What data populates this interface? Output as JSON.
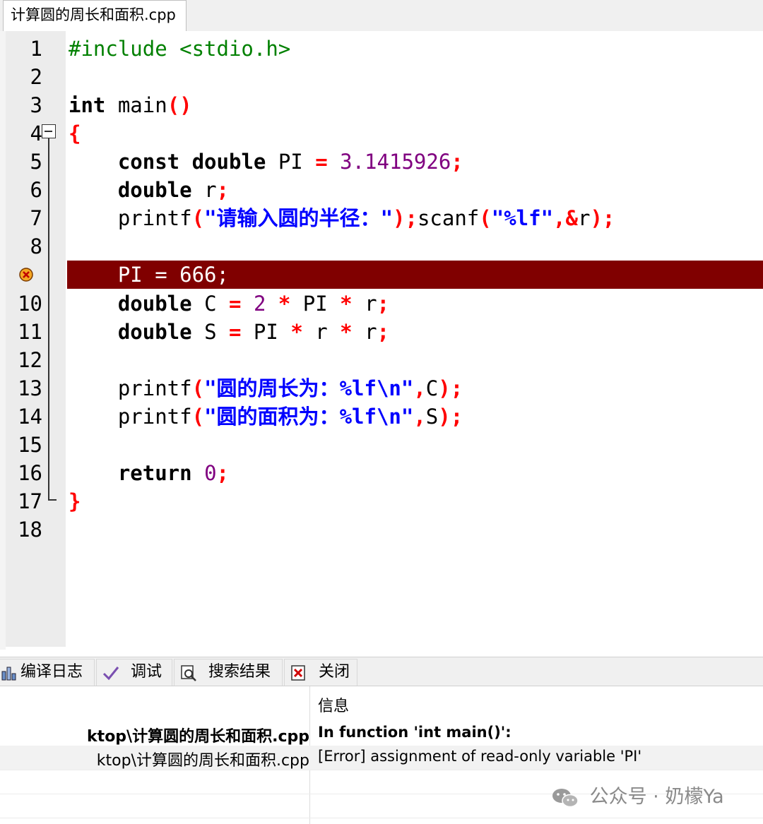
{
  "editor_tab": {
    "filename": "计算圆的周长和面积.cpp"
  },
  "gutter": {
    "line_numbers": [
      "1",
      "2",
      "3",
      "4",
      "5",
      "6",
      "7",
      "8",
      "",
      "10",
      "11",
      "12",
      "13",
      "14",
      "15",
      "16",
      "17",
      "18"
    ],
    "breakpoint_line": 9
  },
  "code": {
    "l1": "#include <stdio.h>",
    "l3": {
      "kw": "int",
      "rest": " main",
      "p": "()"
    },
    "l4": "{",
    "l5": {
      "indent": "    ",
      "kw": "const double",
      "id": " PI ",
      "eq": "=",
      "sp": " ",
      "num": "3.1415926",
      "semi": ";"
    },
    "l6": {
      "indent": "    ",
      "kw": "double",
      "id": " r",
      "semi": ";"
    },
    "l7": {
      "indent": "    ",
      "fn1": "printf",
      "p1": "(",
      "s1q1": "\"",
      "s1": "请输入圆的半径：",
      "s1q2": "\"",
      "p2": ");",
      "fn2": "scanf",
      "p3": "(",
      "s2": "\"%lf\"",
      "c": ",&",
      "id": "r",
      "p4": ");"
    },
    "l9": "    PI = 666;",
    "l10": {
      "indent": "    ",
      "kw": "double",
      "id1": " C ",
      "eq": "=",
      "sp": " ",
      "num": "2",
      "op1": " * ",
      "id2": "PI",
      "op2": " * ",
      "id3": "r",
      "semi": ";"
    },
    "l11": {
      "indent": "    ",
      "kw": "double",
      "id1": " S ",
      "eq": "=",
      "id2": " PI",
      "op1": " * ",
      "id3": "r",
      "op2": " * ",
      "id4": "r",
      "semi": ";"
    },
    "l13": {
      "indent": "    ",
      "fn": "printf",
      "p1": "(",
      "q1": "\"",
      "s": "圆的周长为：",
      "fmt": "%lf\\n\"",
      "c": ",",
      "id": "C",
      "p2": ");"
    },
    "l14": {
      "indent": "    ",
      "fn": "printf",
      "p1": "(",
      "q1": "\"",
      "s": "圆的面积为：",
      "fmt": "%lf\\n\"",
      "c": ",",
      "id": "S",
      "p2": ");"
    },
    "l16": {
      "indent": "    ",
      "kw": "return",
      "sp": " ",
      "num": "0",
      "semi": ";"
    },
    "l17": "}"
  },
  "bottom_tabs": [
    {
      "label": "编译日志",
      "icon": "chart-icon"
    },
    {
      "label": "调试",
      "icon": "check-icon"
    },
    {
      "label": "搜索结果",
      "icon": "search-icon"
    },
    {
      "label": "关闭",
      "icon": "close-icon"
    }
  ],
  "messages": {
    "header_info": "信息",
    "rows": [
      {
        "file": "ktop\\计算圆的周长和面积.cpp",
        "message": "In function 'int main()':",
        "bold": true
      },
      {
        "file": "ktop\\计算圆的周长和面积.cpp",
        "message": "[Error] assignment of read-only variable 'PI'",
        "bold": false
      }
    ]
  },
  "watermark": {
    "text": "公众号 · 奶檬Ya"
  },
  "colors": {
    "error_line": "#800000",
    "keyword": "#000000",
    "preprocessor": "#008000",
    "symbol": "#ff0000",
    "number": "#800080",
    "string": "#0000ff"
  }
}
